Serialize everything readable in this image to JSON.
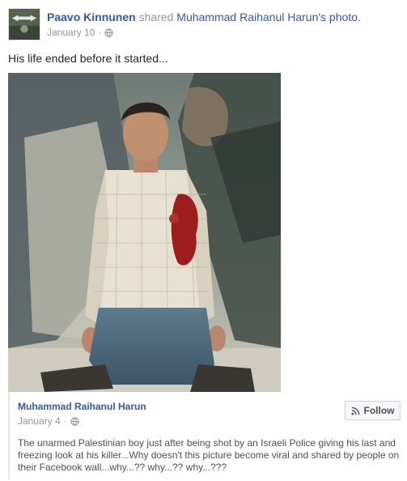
{
  "post": {
    "author": "Paavo Kinnunen",
    "action": " shared ",
    "original_ref": "Muhammad Raihanul Harun's photo.",
    "date": "January 10",
    "separator": "·",
    "privacy_icon": "globe-icon",
    "text": "His life ended before it started..."
  },
  "shared": {
    "author": "Muhammad Raihanul Harun",
    "date": "January 4",
    "separator": "·",
    "privacy_icon": "globe-icon",
    "follow_label": "Follow",
    "follow_icon": "rss-icon",
    "description": "The unarmed Palestinian boy just after being shot by an Israeli Police giving his last and freezing look at his killer...Why doesn't this picture become viral and shared by people on their Facebook wall...why...?? why...?? why...???"
  },
  "colors": {
    "link": "#365899",
    "meta": "#90949c",
    "text": "#1d2129",
    "blood": "#9c1e1e"
  }
}
